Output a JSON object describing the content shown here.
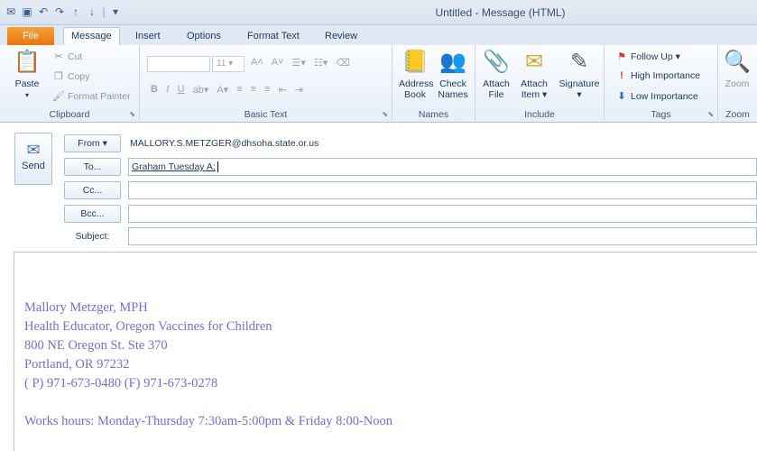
{
  "window": {
    "title": "Untitled - Message (HTML)"
  },
  "qat": [
    "save-icon",
    "undo-icon",
    "redo-icon",
    "arrow-up-icon",
    "arrow-down-icon",
    "customize-icon"
  ],
  "tabs": [
    {
      "label": "File"
    },
    {
      "label": "Message"
    },
    {
      "label": "Insert"
    },
    {
      "label": "Options"
    },
    {
      "label": "Format Text"
    },
    {
      "label": "Review"
    }
  ],
  "ribbon": {
    "clipboard": {
      "label": "Clipboard",
      "paste": "Paste",
      "cut": "Cut",
      "copy": "Copy",
      "format_painter": "Format Painter"
    },
    "basic_text": {
      "label": "Basic Text",
      "font_size": "11",
      "bold": "B",
      "italic": "I",
      "underline": "U"
    },
    "names": {
      "label": "Names",
      "address_book": "Address Book",
      "check_names": "Check Names"
    },
    "include": {
      "label": "Include",
      "attach_file": "Attach File",
      "attach_item": "Attach Item ▾",
      "signature": "Signature ▾"
    },
    "tags": {
      "label": "Tags",
      "follow_up": "Follow Up ▾",
      "high_importance": "High Importance",
      "low_importance": "Low Importance"
    },
    "zoom": {
      "label": "Zoom",
      "zoom": "Zoom"
    }
  },
  "header": {
    "send": "Send",
    "from_label": "From ▾",
    "from_address": "MALLORY.S.METZGER@dhsoha.state.or.us",
    "to_label": "To...",
    "to_value": "Graham Tuesday A;",
    "cc_label": "Cc...",
    "bcc_label": "Bcc...",
    "subject_label": "Subject:",
    "subject_value": ""
  },
  "signature": {
    "name": "Mallory Metzger, MPH",
    "title": "Health Educator, Oregon Vaccines for Children",
    "address1": "800 NE Oregon St. Ste 370",
    "address2": "Portland, OR 97232",
    "phones": "( P) 971-673-0480 (F) 971-673-0278",
    "hours": "Works hours: Monday-Thursday 7:30am-5:00pm & Friday 8:00-Noon"
  },
  "colors": {
    "file_tab": "#e8760d",
    "signature_text": "#6e6fd8",
    "ribbon_text": "#1e395b"
  }
}
